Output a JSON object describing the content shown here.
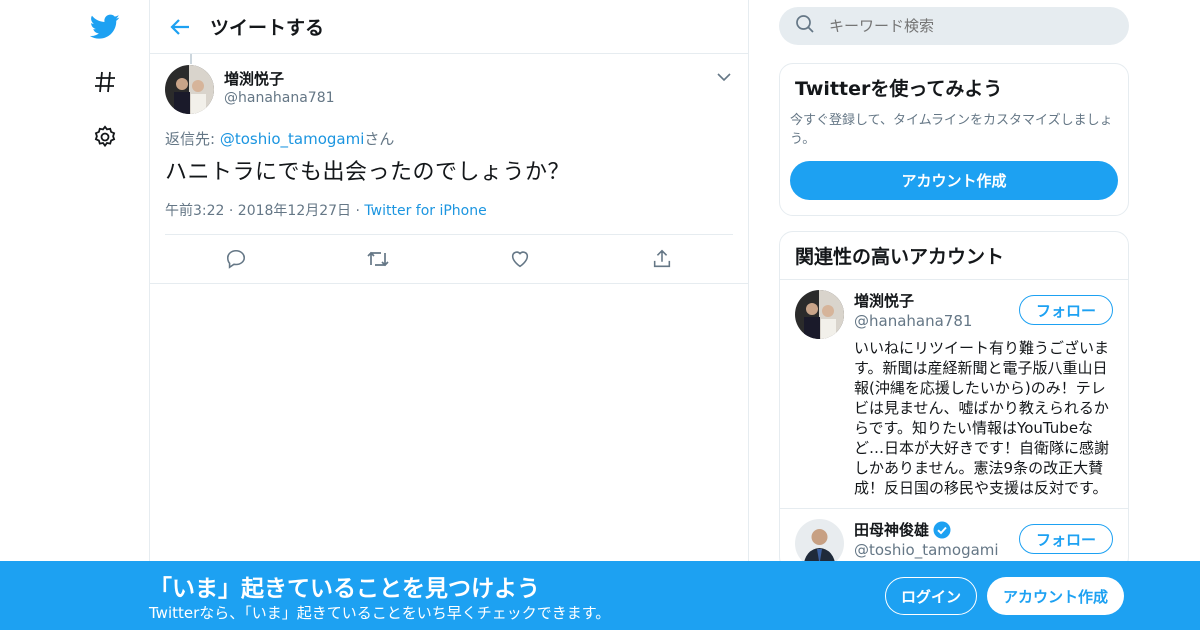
{
  "nav": {
    "icons": [
      "twitter-bird-icon",
      "hashtag-icon",
      "gear-icon"
    ]
  },
  "header": {
    "title": "ツイートする"
  },
  "tweet": {
    "author_name": "増渕悦子",
    "handle": "@hanahana781",
    "reply_prefix": "返信先: ",
    "reply_mention": "@toshio_tamogami",
    "reply_suffix": "さん",
    "text": "ハニトラにでも出会ったのでしょうか？",
    "time": "午前3:22 · 2018年12月27日 · ",
    "source": "Twitter for iPhone"
  },
  "search": {
    "placeholder": "キーワード検索"
  },
  "signup_card": {
    "title": "Twitterを使ってみよう",
    "desc": "今すぐ登録して、タイムラインをカスタマイズしましょう。",
    "button": "アカウント作成"
  },
  "related": {
    "title": "関連性の高いアカウント",
    "users": [
      {
        "name": "増渕悦子",
        "handle": "@hanahana781",
        "bio": "いいねにリツイート有り難うございます。新聞は産経新聞と電子版八重山日報(沖縄を応援したいから)のみ！テレビは見ません、嘘ばかり教えられるからです。知りたい情報はYouTubeなど…日本が大好きです！自衛隊に感謝しかありません。憲法9条の改正大賛成！反日国の移民や支援は反対です。",
        "follow": "フォロー"
      },
      {
        "name": "田母神俊雄",
        "handle": "@toshio_tamogami",
        "bio": "",
        "follow": "フォロー",
        "verified": true
      }
    ]
  },
  "bottom_bar": {
    "title": "「いま」起きていることを見つけよう",
    "subtitle": "Twitterなら、「いま」起きていることをいち早くチェックできます。",
    "login": "ログイン",
    "signup": "アカウント作成"
  },
  "colors": {
    "accent": "#1da1f2",
    "link": "#1b95e0",
    "muted": "#657786",
    "border": "#e6ecf0"
  }
}
